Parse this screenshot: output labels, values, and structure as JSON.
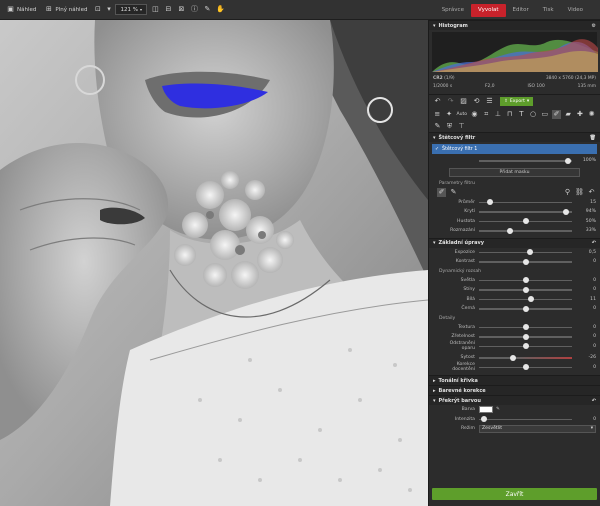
{
  "toolbar": {
    "nahled": "Náhled",
    "plny_nahled": "Plný náhled",
    "zoom": "121 %"
  },
  "tabs": [
    {
      "label": "Správce"
    },
    {
      "label": "Vyvolat"
    },
    {
      "label": "Editor"
    },
    {
      "label": "Tisk"
    },
    {
      "label": "Video"
    }
  ],
  "histogram": {
    "title": "Histogram",
    "format": "CR2",
    "icc": "(1/9)",
    "dims": "3840 x 5760 (24,3 MP)",
    "shutter": "1/2000 s",
    "aperture": "F2,0",
    "iso": "ISO 100",
    "focal": "135 mm"
  },
  "toolbar2": {
    "auto": "Auto",
    "export": "Export"
  },
  "brush_filter": {
    "title": "Štětcový filtr",
    "item": "Štětcový filtr 1",
    "opacity_val": "100%",
    "add_mask": "Přidat masku",
    "params_label": "Parametry filtru"
  },
  "filter_params": [
    {
      "label": "Průměr",
      "value": "15",
      "pos": 0.12
    },
    {
      "label": "Krytí",
      "value": "94%",
      "pos": 0.94
    },
    {
      "label": "Hustota",
      "value": "50%",
      "pos": 0.5
    },
    {
      "label": "Rozmazání",
      "value": "33%",
      "pos": 0.33
    }
  ],
  "basic": {
    "title": "Základní úpravy",
    "exposure": {
      "label": "Expozice",
      "value": "0,5",
      "pos": 0.55
    },
    "contrast": {
      "label": "Kontrast",
      "value": "0",
      "pos": 0.5
    },
    "dyn_label": "Dynamický rozsah",
    "dyn": [
      {
        "label": "Světla",
        "value": "0",
        "pos": 0.5
      },
      {
        "label": "Stíny",
        "value": "0",
        "pos": 0.5
      },
      {
        "label": "Bílá",
        "value": "11",
        "pos": 0.56
      },
      {
        "label": "Černá",
        "value": "0",
        "pos": 0.5
      }
    ],
    "detail_label": "Detaily",
    "details": [
      {
        "label": "Textura",
        "value": "0",
        "pos": 0.5
      },
      {
        "label": "Zřetelnost",
        "value": "0",
        "pos": 0.5
      },
      {
        "label": "Odstranění oparu",
        "value": "0",
        "pos": 0.5
      }
    ],
    "saturation": {
      "label": "Sytost",
      "value": "-26",
      "pos": 0.37
    },
    "chroma": {
      "label": "Korekce docentění",
      "value": "0",
      "pos": 0.5
    }
  },
  "sections": {
    "tonal": "Tonální křivka",
    "color": "Barevné korekce",
    "overlay": "Překrýt barvou"
  },
  "overlay": {
    "color_label": "Barva",
    "intensity_label": "Intenzita",
    "intensity_value": "0",
    "intensity_pos": 0.05,
    "mode_label": "Režim",
    "mode_value": "Zesvětlit",
    "swatch": "#ffffff"
  },
  "close_label": "Zavřít",
  "colors": {
    "accent_red": "#c8222b",
    "export_green": "#5e9e2b",
    "selection_blue": "#3a6fb0",
    "lips_blue": "#2f2fe0"
  }
}
